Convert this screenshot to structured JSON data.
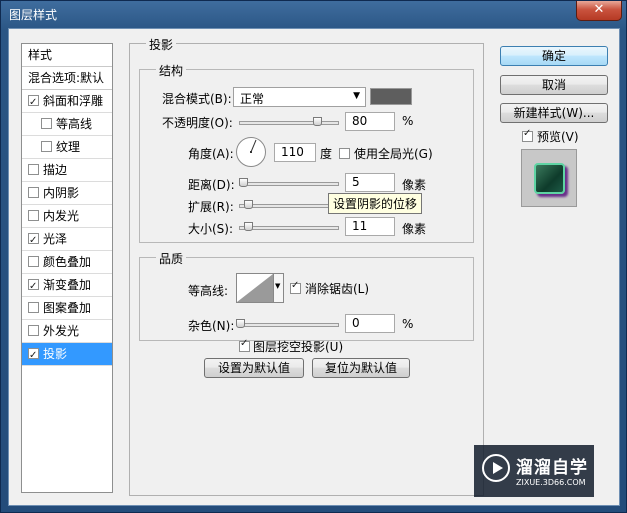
{
  "window": {
    "title": "图层样式",
    "close_icon": "✕"
  },
  "style_list": {
    "header": "样式",
    "blending_options": "混合选项:默认",
    "items": [
      {
        "label": "斜面和浮雕",
        "checked": true
      },
      {
        "label": "等高线",
        "checked": false
      },
      {
        "label": "纹理",
        "checked": false
      },
      {
        "label": "描边",
        "checked": false
      },
      {
        "label": "内阴影",
        "checked": false
      },
      {
        "label": "内发光",
        "checked": false
      },
      {
        "label": "光泽",
        "checked": true
      },
      {
        "label": "颜色叠加",
        "checked": false
      },
      {
        "label": "渐变叠加",
        "checked": true
      },
      {
        "label": "图案叠加",
        "checked": false
      },
      {
        "label": "外发光",
        "checked": false
      },
      {
        "label": "投影",
        "checked": true,
        "selected": true
      }
    ]
  },
  "drop_shadow": {
    "section_title": "投影",
    "structure": {
      "title": "结构",
      "blend_mode_label": "混合模式(B):",
      "blend_mode_value": "正常",
      "shadow_color": "#5e5e5e",
      "opacity_label": "不透明度(O):",
      "opacity_value": "80",
      "opacity_unit": "%",
      "angle_label": "角度(A):",
      "angle_value": "110",
      "angle_unit": "度",
      "global_light_label": "使用全局光(G)",
      "global_light_checked": false,
      "distance_label": "距离(D):",
      "distance_value": "5",
      "distance_unit": "像素",
      "spread_label": "扩展(R):",
      "spread_unit": "%",
      "size_label": "大小(S):",
      "size_value": "11",
      "size_unit": "像素",
      "tooltip": "设置阴影的位移"
    },
    "quality": {
      "title": "品质",
      "contour_label": "等高线:",
      "anti_alias_label": "消除锯齿(L)",
      "anti_alias_checked": true,
      "noise_label": "杂色(N):",
      "noise_value": "0",
      "noise_unit": "%"
    },
    "knockout_label": "图层挖空投影(U)",
    "knockout_checked": true,
    "make_default_button": "设置为默认值",
    "reset_default_button": "复位为默认值"
  },
  "right_panel": {
    "ok_button": "确定",
    "cancel_button": "取消",
    "new_style_button": "新建样式(W)...",
    "preview_label": "预览(V)",
    "preview_checked": true
  },
  "watermark": {
    "name": "溜溜自学",
    "url": "ZIXUE.3D66.COM"
  }
}
